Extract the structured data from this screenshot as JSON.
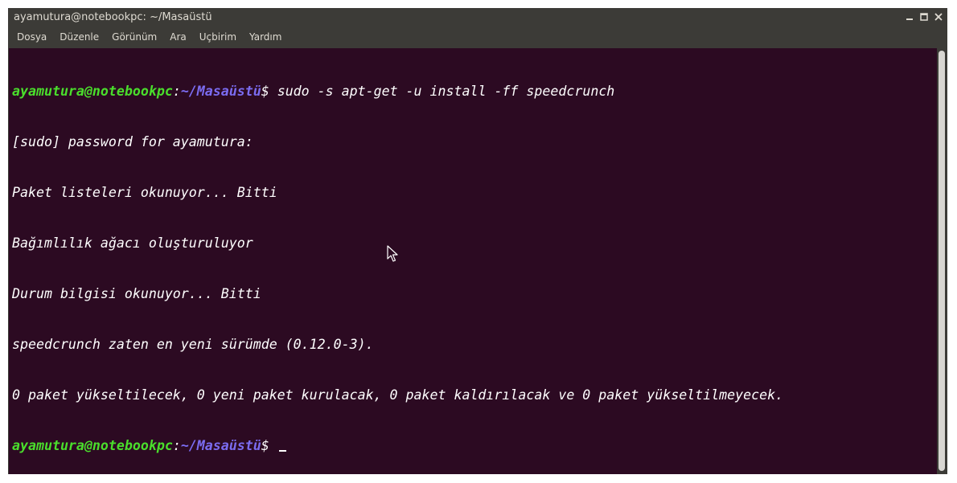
{
  "window": {
    "title": "ayamutura@notebookpc: ~/Masaüstü",
    "controls": [
      "minimize-icon",
      "maximize-icon",
      "close-icon"
    ]
  },
  "menu": {
    "items": [
      {
        "label": "Dosya"
      },
      {
        "label": "Düzenle"
      },
      {
        "label": "Görünüm"
      },
      {
        "label": "Ara"
      },
      {
        "label": "Uçbirim"
      },
      {
        "label": "Yardım"
      }
    ]
  },
  "terminal": {
    "prompt": {
      "user_host": "ayamutura@notebookpc",
      "colon": ":",
      "path": "~/Masaüstü",
      "symbol": "$ "
    },
    "command": "sudo -s apt-get -u install -ff speedcrunch",
    "output": [
      "[sudo] password for ayamutura:",
      "Paket listeleri okunuyor... Bitti",
      "Bağımlılık ağacı oluşturuluyor",
      "Durum bilgisi okunuyor... Bitti",
      "speedcrunch zaten en yeni sürümde (0.12.0-3).",
      "0 paket yükseltilecek, 0 yeni paket kurulacak, 0 paket kaldırılacak ve 0 paket yükseltilmeyecek."
    ]
  },
  "colors": {
    "terminal_bg": "#2c0a22",
    "prompt_user": "#4ade2c",
    "prompt_path": "#7b6cf1",
    "chrome_bg": "#3c3b37",
    "chrome_text": "#dfdbd2"
  }
}
